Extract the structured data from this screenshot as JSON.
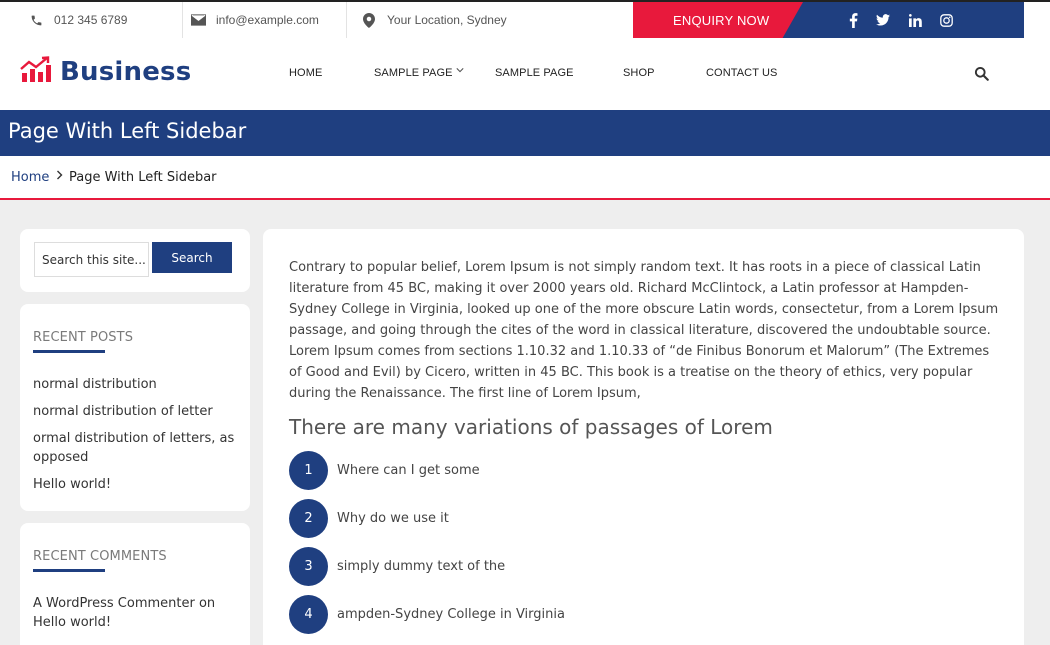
{
  "topbar": {
    "phone": "012 345 6789",
    "email": "info@example.com",
    "location": "Your Location, Sydney",
    "enquiry_label": "ENQUIRY NOW",
    "social": [
      "facebook-icon",
      "twitter-icon",
      "linkedin-icon",
      "instagram-icon"
    ]
  },
  "header": {
    "brand": "Business",
    "nav": [
      {
        "label": "HOME"
      },
      {
        "label": "SAMPLE PAGE"
      },
      {
        "label": "SAMPLE PAGE"
      },
      {
        "label": "SHOP"
      },
      {
        "label": "CONTACT US"
      }
    ]
  },
  "page": {
    "title": "Page With Left Sidebar",
    "breadcrumb": {
      "home": "Home",
      "current": "Page With Left Sidebar"
    }
  },
  "sidebar": {
    "search": {
      "placeholder": "Search this site...",
      "button": "Search"
    },
    "recent_posts": {
      "title": "RECENT POSTS",
      "items": [
        "normal distribution",
        "normal distribution of letter",
        "ormal distribution of letters, as opposed",
        "Hello world!"
      ]
    },
    "recent_comments": {
      "title": "RECENT COMMENTS",
      "author": "A WordPress Commenter",
      "connector": "on",
      "post": "Hello world!"
    }
  },
  "main": {
    "paragraph": "Contrary to popular belief, Lorem Ipsum is not simply random text. It has roots in a piece of classical Latin literature from 45 BC, making it over 2000 years old. Richard McClintock, a Latin professor at Hampden-Sydney College in Virginia, looked up one of the more obscure Latin words, consectetur, from a Lorem Ipsum passage, and going through the cites of the word in classical literature, discovered the undoubtable source. Lorem Ipsum comes from sections 1.10.32 and 1.10.33 of “de Finibus Bonorum et Malorum” (The Extremes of Good and Evil) by Cicero, written in 45 BC. This book is a treatise on the theory of ethics, very popular during the Renaissance. The first line of Lorem Ipsum,",
    "heading": "There are many variations of passages of Lorem",
    "list": [
      {
        "num": "1",
        "text": "Where can I get some"
      },
      {
        "num": "2",
        "text": "Why do we use it"
      },
      {
        "num": "3",
        "text": "simply dummy text of the"
      },
      {
        "num": "4",
        "text": "ampden-Sydney College in Virginia"
      }
    ]
  },
  "colors": {
    "primary": "#1f3f80",
    "accent": "#e8193c"
  }
}
